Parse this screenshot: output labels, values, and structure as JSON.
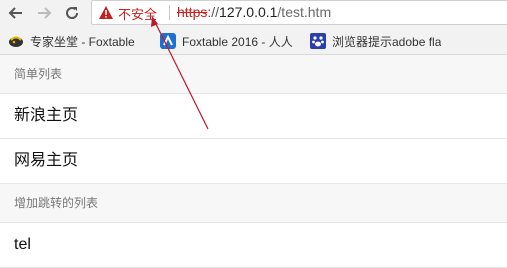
{
  "toolbar": {
    "back_icon": "arrow-left-icon",
    "forward_icon": "arrow-right-icon",
    "reload_icon": "reload-icon"
  },
  "address_bar": {
    "security_label": "不安全",
    "url_scheme": "https",
    "url_sep": "://",
    "url_host": "127.0.0.1",
    "url_path": "/test.htm",
    "warning_color": "#c5221f"
  },
  "bookmarks": [
    {
      "label": "专家坐堂 - Foxtable",
      "icon": "foxtable-icon"
    },
    {
      "label": "Foxtable 2016 - 人人",
      "icon": "foxtable-2016-icon"
    },
    {
      "label": "浏览器提示adobe fla",
      "icon": "paw-icon"
    }
  ],
  "sections": [
    {
      "header": "简单列表",
      "items": [
        "新浪主页",
        "网易主页"
      ]
    },
    {
      "header": "增加跳转的列表",
      "items": [
        "tel"
      ]
    }
  ],
  "annotation": {
    "color": "#c0152a",
    "icon": "red-arrow-annotation"
  }
}
